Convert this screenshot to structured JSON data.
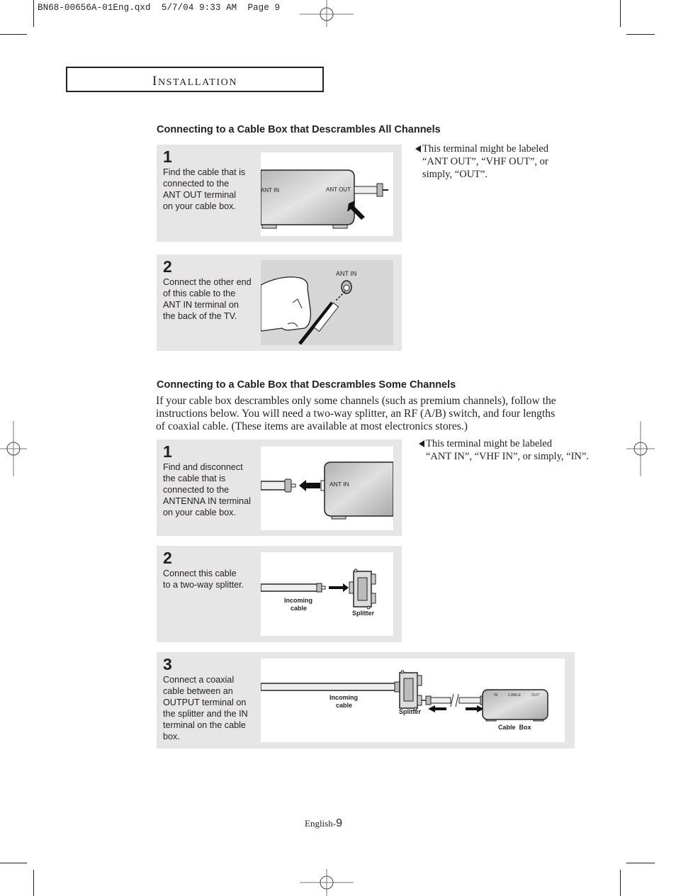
{
  "slug": {
    "file": "BN68-00656A-01Eng.qxd",
    "date": "5/7/04",
    "time": "9:33 AM",
    "page_label": "Page 9"
  },
  "section": {
    "title_cap": "I",
    "title_rest": "NSTALLATION"
  },
  "part1": {
    "heading": "Connecting to a Cable Box that Descrambles All Channels",
    "note_lines": [
      "This terminal might be labeled",
      "“ANT OUT”, “VHF OUT”, or",
      "simply, “OUT”."
    ],
    "steps": [
      {
        "number": "1",
        "text_lines": [
          "Find the cable that is",
          "connected to the",
          "ANT OUT terminal",
          "on your cable box."
        ],
        "figure_labels": {
          "left": "ANT IN",
          "right": "ANT OUT"
        }
      },
      {
        "number": "2",
        "text_lines": [
          "Connect the other end",
          "of this cable to the",
          "ANT IN terminal on",
          "the back of the TV."
        ],
        "figure_labels": {
          "terminal": "ANT IN"
        }
      }
    ]
  },
  "part2": {
    "heading": "Connecting to a Cable Box that Descrambles Some Channels",
    "intro_lines": [
      "If your cable box descrambles only some channels (such as premium channels), follow the",
      "instructions below. You will need a two-way splitter, an RF (A/B) switch, and four lengths",
      "of coaxial cable. (These items are available at most electronics stores.)"
    ],
    "note_lines": [
      "This terminal might be labeled",
      "“ANT IN”, “VHF IN”, or simply, “IN”."
    ],
    "steps": [
      {
        "number": "1",
        "text_lines": [
          "Find and disconnect",
          "the cable that is",
          "connected to the",
          "ANTENNA IN terminal",
          "on your cable box."
        ],
        "figure_labels": {
          "terminal": "ANT IN"
        }
      },
      {
        "number": "2",
        "text_lines": [
          "Connect this cable",
          "to a two-way splitter."
        ],
        "figure_labels": {
          "cable_1": "Incoming",
          "cable_2": "cable",
          "splitter": "Splitter"
        }
      },
      {
        "number": "3",
        "text_lines": [
          "Connect a coaxial",
          "cable between an",
          "OUTPUT terminal on",
          "the splitter and the IN",
          "terminal on the cable",
          "box."
        ],
        "figure_labels": {
          "cable_1": "Incoming",
          "cable_2": "cable",
          "splitter": "Splitter",
          "box_in": "IN",
          "box_cable": "CABLE",
          "box_out": "OUT",
          "box": "Cable  Box"
        }
      }
    ]
  },
  "footer": {
    "language": "English-",
    "page_number": "9"
  }
}
